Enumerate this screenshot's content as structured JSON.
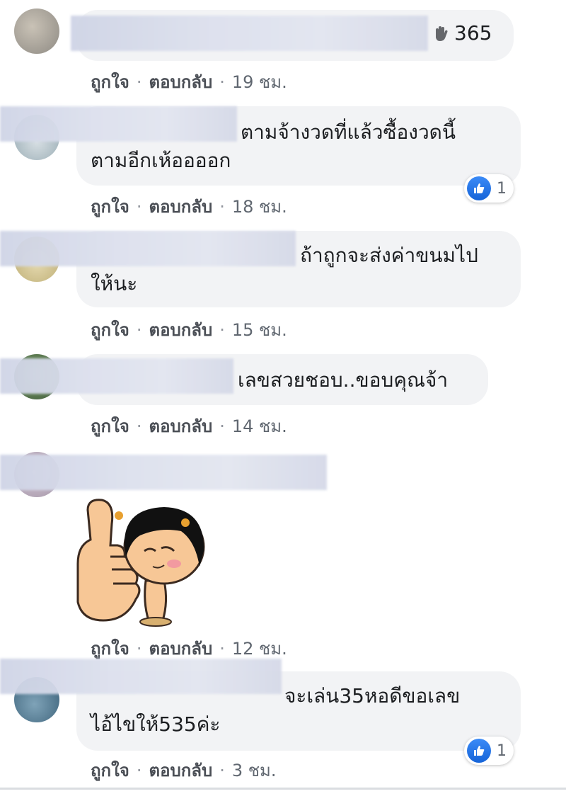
{
  "actions": {
    "like": "ถูกใจ",
    "reply": "ตอบกลับ",
    "sep": "·"
  },
  "comments": [
    {
      "text_line1": "",
      "text_line2": "",
      "inline_reaction_count": "365",
      "time": "19 ชม."
    },
    {
      "text_line1": "ตามจ้างวดที่แล้วซื้องวดนี้",
      "text_line2": "ตามอีกเห้ออออก",
      "like_count": "1",
      "time": "18 ชม."
    },
    {
      "text_line1": "ถ้าถูกจะส่งค่าขนมไป",
      "text_line2": "ให้นะ",
      "time": "15 ชม."
    },
    {
      "text_line1": "เลขสวยชอบ..ขอบคุณจ้า",
      "text_line2": "",
      "time": "14 ชม."
    },
    {
      "text_line1": "",
      "text_line2": "",
      "sticker": "thumbs-up-girl-sticker",
      "time": "12 ชม."
    },
    {
      "text_line1": "จะเล่น35หอดีขอเลข",
      "text_line2": "ไอ้ไขให้535ค่ะ",
      "like_count": "1",
      "time": "3 ชม."
    }
  ],
  "icons": {
    "inline_reaction": "hand-icon",
    "like": "thumbs-up-icon"
  },
  "colors": {
    "like_blue": "#1877f2",
    "bubble": "#f2f3f5",
    "meta": "#606770"
  }
}
